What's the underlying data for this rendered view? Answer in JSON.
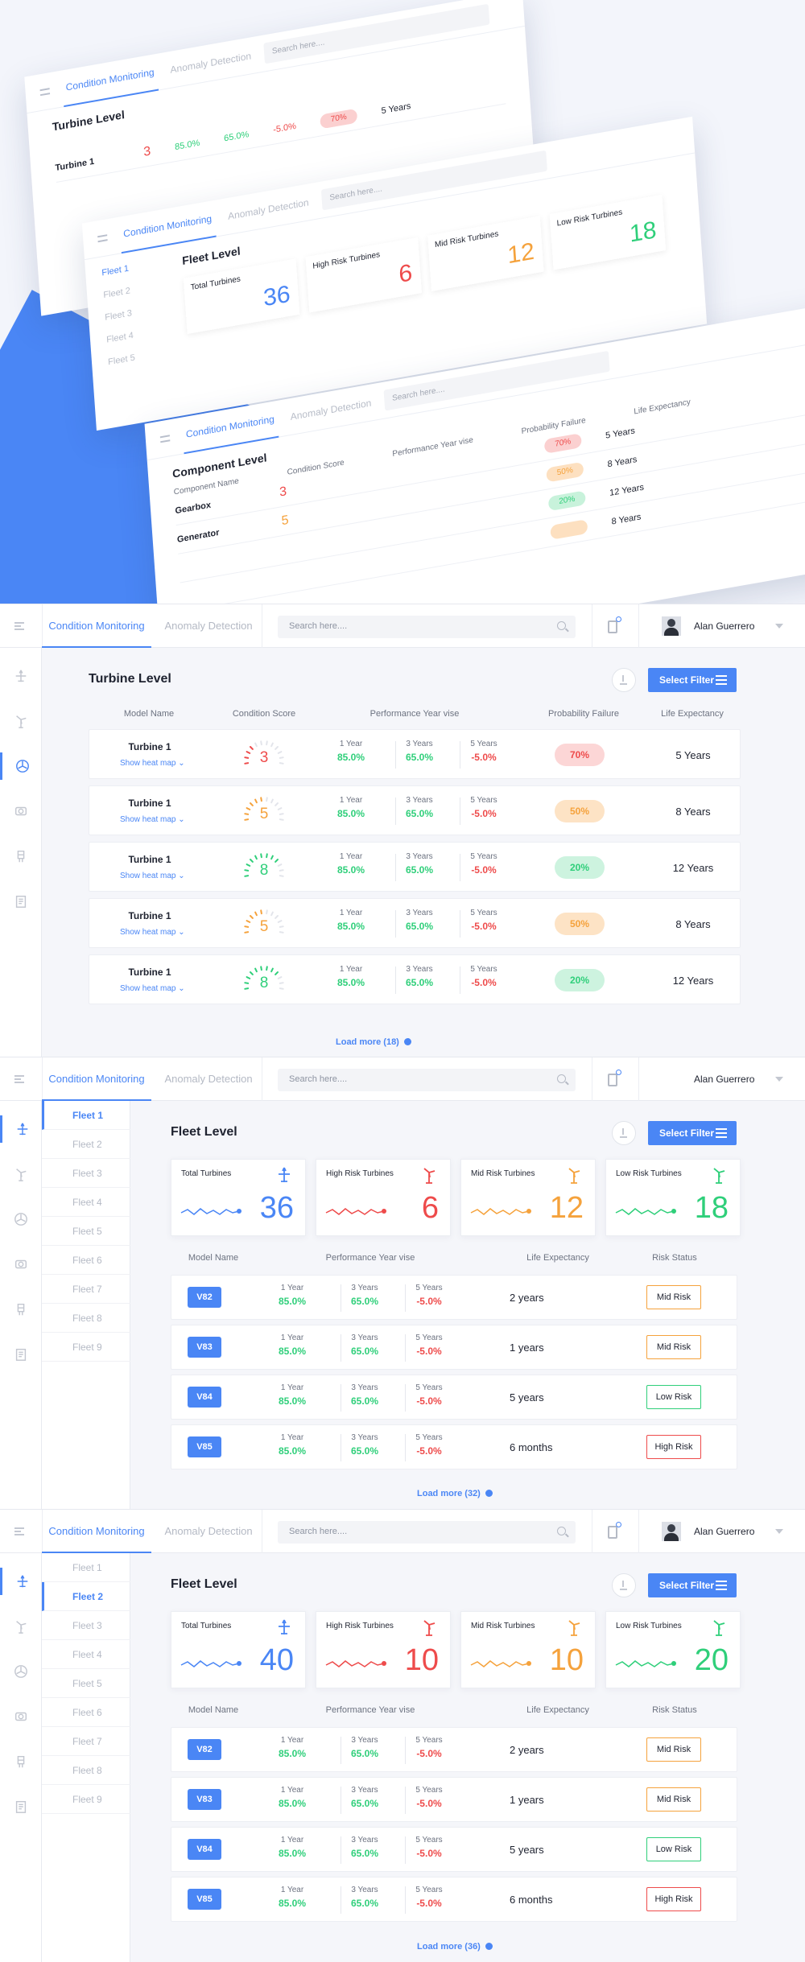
{
  "colors": {
    "accent": "#4a86f5",
    "red": "#ee4b4b",
    "orange": "#f5a23c",
    "green": "#2fcf7a",
    "bg": "#f5f6fa"
  },
  "nav": {
    "tab_active": "Condition Monitoring",
    "tab_inactive": "Anomaly Detection",
    "search_placeholder": "Search here....",
    "user_name": "Alan Guerrero"
  },
  "icons": [
    "plane-icon",
    "wind-turbine-icon",
    "fan-icon",
    "gearbox-icon",
    "generator-icon",
    "report-icon"
  ],
  "buttons": {
    "select_filter": "Select Filter"
  },
  "hero": {
    "turbine_title": "Turbine Level",
    "fleet_title": "Fleet Level",
    "component_title": "Component Level",
    "turbine_row": {
      "model": "Turbine 1",
      "heat": "Show heat map",
      "score": "3",
      "y1": "85.0%",
      "y3": "65.0%",
      "y5": "-5.0%",
      "prob": "70%",
      "life": "5 Years"
    },
    "fleet_kpis": [
      {
        "label": "Total Turbines",
        "value": "36"
      },
      {
        "label": "High Risk Turbines",
        "value": "6"
      },
      {
        "label": "Mid Risk Turbines",
        "value": "12"
      },
      {
        "label": "Low Risk Turbines",
        "value": "18"
      }
    ],
    "component_headers": [
      "Component Name",
      "Condition Score",
      "Performance Year vise",
      "Probability Failure",
      "Life Expectancy"
    ],
    "components": [
      {
        "name": "Gearbox",
        "heat": "Show heat map",
        "score": "3",
        "prob": "70%",
        "life": "5 Years",
        "tone": "red"
      },
      {
        "name": "Generator",
        "heat": "Show heat map",
        "score": "5",
        "prob": "50%",
        "life": "8 Years",
        "tone": "orange"
      },
      {
        "name": "",
        "heat": "",
        "score": "",
        "prob": "20%",
        "life": "12 Years",
        "tone": "green"
      },
      {
        "name": "",
        "heat": "",
        "score": "",
        "prob": "",
        "life": "8 Years",
        "tone": "orange"
      }
    ],
    "fleet_menu": [
      "Fleet 1",
      "Fleet 2",
      "Fleet 3",
      "Fleet 4",
      "Fleet 5"
    ]
  },
  "turbine": {
    "title": "Turbine Level",
    "headers": {
      "model": "Model Name",
      "score": "Condition Score",
      "perf": "Performance Year vise",
      "prob": "Probability Failure",
      "life": "Life Expectancy"
    },
    "perf_labels": [
      "1 Year",
      "3 Years",
      "5 Years"
    ],
    "rows": [
      {
        "model": "Turbine 1",
        "heat": "Show heat map",
        "score": "3",
        "y1": "85.0%",
        "y3": "65.0%",
        "y5": "-5.0%",
        "prob": "70%",
        "life": "5 Years",
        "tone": "red",
        "level": 0.3
      },
      {
        "model": "Turbine 1",
        "heat": "Show heat map",
        "score": "5",
        "y1": "85.0%",
        "y3": "65.0%",
        "y5": "-5.0%",
        "prob": "50%",
        "life": "8 Years",
        "tone": "orange",
        "level": 0.5
      },
      {
        "model": "Turbine 1",
        "heat": "Show heat map",
        "score": "8",
        "y1": "85.0%",
        "y3": "65.0%",
        "y5": "-5.0%",
        "prob": "20%",
        "life": "12 Years",
        "tone": "green",
        "level": 0.8
      },
      {
        "model": "Turbine 1",
        "heat": "Show heat map",
        "score": "5",
        "y1": "85.0%",
        "y3": "65.0%",
        "y5": "-5.0%",
        "prob": "50%",
        "life": "8 Years",
        "tone": "orange",
        "level": 0.5
      },
      {
        "model": "Turbine 1",
        "heat": "Show heat map",
        "score": "8",
        "y1": "85.0%",
        "y3": "65.0%",
        "y5": "-5.0%",
        "prob": "20%",
        "life": "12 Years",
        "tone": "green",
        "level": 0.8
      }
    ],
    "load_more": "Load more (18)"
  },
  "fleet_screens": [
    {
      "title": "Fleet Level",
      "fleets": [
        "Fleet 1",
        "Fleet 2",
        "Fleet 3",
        "Fleet 4",
        "Fleet 5",
        "Fleet 6",
        "Fleet 7",
        "Fleet 8",
        "Fleet 9"
      ],
      "active_fleet": 0,
      "kpis": [
        {
          "label": "Total Turbines",
          "value": "36",
          "tone": "blue"
        },
        {
          "label": "High Risk Turbines",
          "value": "6",
          "tone": "red"
        },
        {
          "label": "Mid Risk Turbines",
          "value": "12",
          "tone": "orange"
        },
        {
          "label": "Low Risk Turbines",
          "value": "18",
          "tone": "green"
        }
      ],
      "headers": {
        "model": "Model Name",
        "perf": "Performance Year vise",
        "life": "Life Expectancy",
        "risk": "Risk Status"
      },
      "perf_labels": [
        "1 Year",
        "3 Years",
        "5 Years"
      ],
      "rows": [
        {
          "model": "V82",
          "y1": "85.0%",
          "y3": "65.0%",
          "y5": "-5.0%",
          "life": "2 years",
          "risk": "Mid Risk",
          "tone": "orange"
        },
        {
          "model": "V83",
          "y1": "85.0%",
          "y3": "65.0%",
          "y5": "-5.0%",
          "life": "1 years",
          "risk": "Mid Risk",
          "tone": "orange"
        },
        {
          "model": "V84",
          "y1": "85.0%",
          "y3": "65.0%",
          "y5": "-5.0%",
          "life": "5 years",
          "risk": "Low Risk",
          "tone": "green"
        },
        {
          "model": "V85",
          "y1": "85.0%",
          "y3": "65.0%",
          "y5": "-5.0%",
          "life": "6 months",
          "risk": "High Risk",
          "tone": "red"
        }
      ],
      "load_more": "Load more (32)"
    },
    {
      "title": "Fleet Level",
      "fleets": [
        "Fleet 1",
        "Fleet 2",
        "Fleet 3",
        "Fleet 4",
        "Fleet 5",
        "Fleet 6",
        "Fleet 7",
        "Fleet 8",
        "Fleet 9"
      ],
      "active_fleet": 1,
      "kpis": [
        {
          "label": "Total Turbines",
          "value": "40",
          "tone": "blue"
        },
        {
          "label": "High Risk Turbines",
          "value": "10",
          "tone": "red"
        },
        {
          "label": "Mid Risk Turbines",
          "value": "10",
          "tone": "orange"
        },
        {
          "label": "Low Risk Turbines",
          "value": "20",
          "tone": "green"
        }
      ],
      "headers": {
        "model": "Model Name",
        "perf": "Performance Year vise",
        "life": "Life Expectancy",
        "risk": "Risk Status"
      },
      "perf_labels": [
        "1 Year",
        "3 Years",
        "5 Years"
      ],
      "rows": [
        {
          "model": "V82",
          "y1": "85.0%",
          "y3": "65.0%",
          "y5": "-5.0%",
          "life": "2 years",
          "risk": "Mid Risk",
          "tone": "orange"
        },
        {
          "model": "V83",
          "y1": "85.0%",
          "y3": "65.0%",
          "y5": "-5.0%",
          "life": "1 years",
          "risk": "Mid Risk",
          "tone": "orange"
        },
        {
          "model": "V84",
          "y1": "85.0%",
          "y3": "65.0%",
          "y5": "-5.0%",
          "life": "5 years",
          "risk": "Low Risk",
          "tone": "green"
        },
        {
          "model": "V85",
          "y1": "85.0%",
          "y3": "65.0%",
          "y5": "-5.0%",
          "life": "6 months",
          "risk": "High Risk",
          "tone": "red"
        }
      ],
      "load_more": "Load more (36)"
    }
  ]
}
